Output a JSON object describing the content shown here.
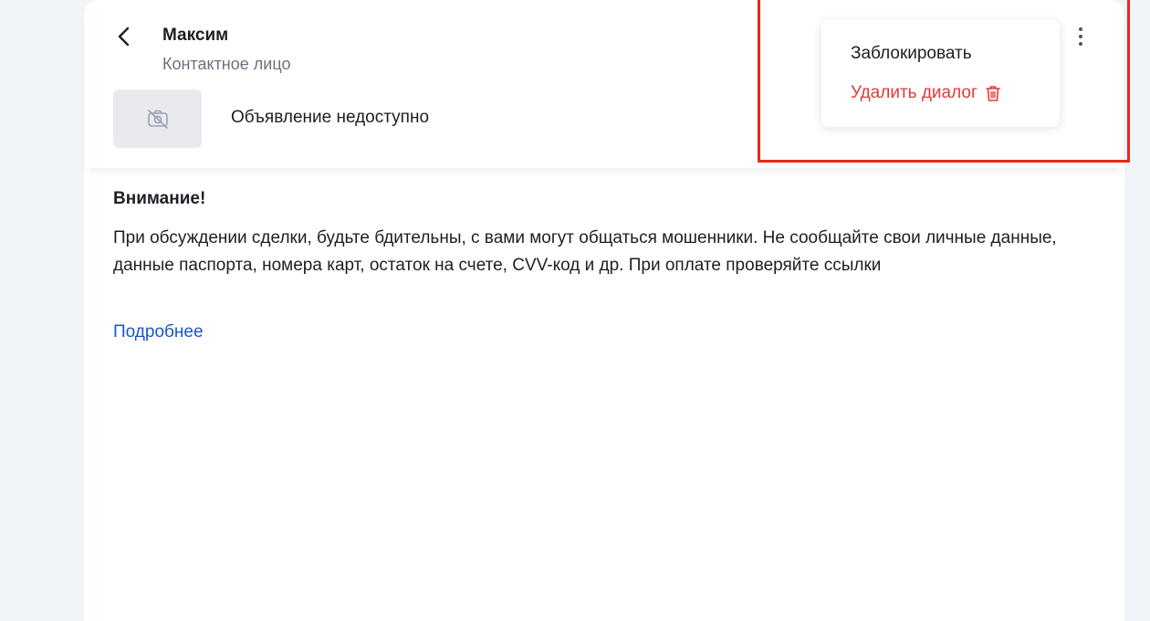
{
  "header": {
    "contact_name": "Максим",
    "contact_role": "Контактное лицо",
    "ad_title": "Объявление недоступно"
  },
  "menu": {
    "block_label": "Заблокировать",
    "delete_label": "Удалить диалог"
  },
  "warning": {
    "title": "Внимание!",
    "text": "При обсуждении сделки, будьте бдительны, с вами могут общаться мошенники. Не сообщайте свои личные данные, данные паспорта, номера карт, остаток на счете, CVV-код и др. При оплате проверяйте ссылки",
    "more_link": "Подробнее"
  },
  "icons": {
    "back": "chevron-left-icon",
    "ad_placeholder": "camera-off-icon",
    "more": "more-vertical-icon",
    "delete": "trash-icon"
  },
  "colors": {
    "accent_red": "#e33a3a",
    "link_blue": "#1a54c8",
    "highlight_red": "#e8281a",
    "page_background": "#f1f4f8"
  }
}
